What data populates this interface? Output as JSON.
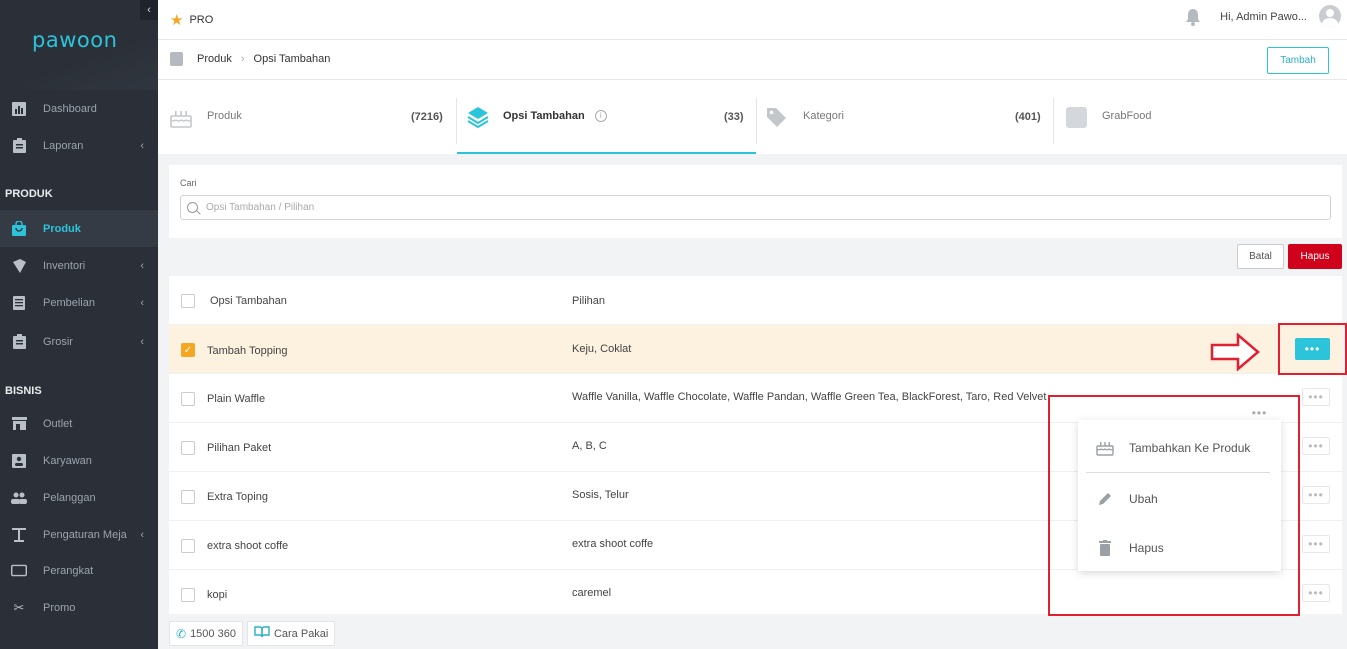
{
  "brand": {
    "logo_text": "pawoon",
    "accent": "#2bc4da"
  },
  "sidebar": {
    "collapse_icon": "chevron-left-icon",
    "items_top": [
      {
        "label": "Dashboard",
        "icon": "bar-chart-icon"
      },
      {
        "label": "Laporan",
        "icon": "clipboard-icon",
        "has_children": true
      }
    ],
    "section_produk": "PRODUK",
    "items_produk": [
      {
        "label": "Produk",
        "icon": "shopping-bag-icon",
        "active": true
      },
      {
        "label": "Inventori",
        "icon": "box-icon",
        "has_children": true
      },
      {
        "label": "Pembelian",
        "icon": "document-icon",
        "has_children": true
      },
      {
        "label": "Grosir",
        "icon": "clipboard-icon",
        "has_children": true
      }
    ],
    "section_bisnis": "BISNIS",
    "items_bisnis": [
      {
        "label": "Outlet",
        "icon": "store-icon"
      },
      {
        "label": "Karyawan",
        "icon": "id-card-icon"
      },
      {
        "label": "Pelanggan",
        "icon": "people-icon"
      },
      {
        "label": "Pengaturan Meja",
        "icon": "table-icon",
        "has_children": true
      },
      {
        "label": "Perangkat",
        "icon": "tablet-icon"
      },
      {
        "label": "Promo",
        "icon": "scissors-icon"
      }
    ]
  },
  "topbar": {
    "plan": "PRO",
    "greeting": "Hi, Admin Pawo..."
  },
  "breadcrumb": {
    "root": "Produk",
    "current": "Opsi Tambahan",
    "add_button": "Tambah"
  },
  "tabs": [
    {
      "label": "Produk",
      "count": "(7216)"
    },
    {
      "label": "Opsi Tambahan",
      "count": "(33)",
      "active": true
    },
    {
      "label": "Kategori",
      "count": "(401)"
    },
    {
      "label": "GrabFood",
      "count": ""
    }
  ],
  "search": {
    "label": "Cari",
    "placeholder": "Opsi Tambahan / Pilihan",
    "value": ""
  },
  "actions": {
    "cancel": "Batal",
    "delete": "Hapus",
    "delete_color": "#d0021b"
  },
  "table": {
    "headers": {
      "col1": "Opsi Tambahan",
      "col2": "Pilihan"
    },
    "rows": [
      {
        "name": "Tambah Topping",
        "options": "Keju, Coklat",
        "checked": true
      },
      {
        "name": "Plain Waffle",
        "options": "Waffle Vanilla, Waffle Chocolate, Waffle Pandan, Waffle Green Tea, BlackForest, Taro, Red Velvet",
        "checked": false
      },
      {
        "name": "Pilihan Paket",
        "options": "A, B, C",
        "checked": false
      },
      {
        "name": "Extra Toping",
        "options": "Sosis, Telur",
        "checked": false
      },
      {
        "name": "extra shoot coffe",
        "options": "extra shoot coffe",
        "checked": false
      },
      {
        "name": "kopi",
        "options": "caremel",
        "checked": false
      }
    ]
  },
  "row_menu": {
    "items": [
      {
        "label": "Tambahkan Ke Produk",
        "icon": "cake-icon"
      },
      {
        "label": "Ubah",
        "icon": "pencil-icon"
      },
      {
        "label": "Hapus",
        "icon": "trash-icon"
      }
    ]
  },
  "footer": {
    "phone": "1500 360",
    "guide": "Cara Pakai"
  }
}
